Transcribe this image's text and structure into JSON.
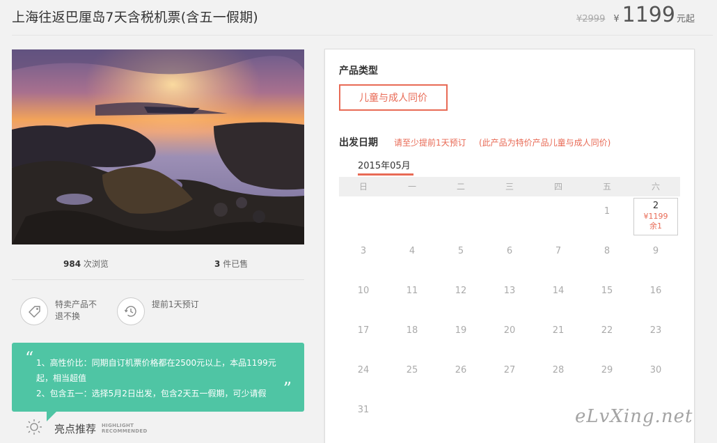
{
  "header": {
    "title": "上海往返巴厘岛7天含税机票(含五一假期)",
    "price_old": "¥2999",
    "currency": "¥",
    "price": "1199",
    "price_suffix": "元起"
  },
  "stats": {
    "views_num": "984",
    "views_label": "次浏览",
    "sold_num": "3",
    "sold_label": "件已售"
  },
  "features": [
    {
      "icon": "tag-icon",
      "text": "特卖产品不退不换"
    },
    {
      "icon": "clock-history-icon",
      "text": "提前1天预订"
    }
  ],
  "highlight": {
    "line1": "1、高性价比：同期自订机票价格都在2500元以上，本品1199元起，相当超值",
    "line2": "2、包含五一：选择5月2日出发，包含2天五一假期，可少请假",
    "quote_open": "“",
    "quote_close": "”",
    "label": "亮点推荐",
    "label_en1": "HIGHLIGHT",
    "label_en2": "RECOMMENDED",
    "accent": "#4fc5a4"
  },
  "panel": {
    "product_type_label": "产品类型",
    "product_type_option": "儿童与成人同价",
    "departure_label": "出发日期",
    "note1": "请至少提前1天预订",
    "note2": "(此产品为特价产品儿童与成人同价)",
    "accent": "#e86a55"
  },
  "calendar": {
    "month": "2015年05月",
    "weekdays": [
      "日",
      "一",
      "二",
      "三",
      "四",
      "五",
      "六"
    ],
    "first_weekday": 5,
    "days": [
      "1",
      "2",
      "3",
      "4",
      "5",
      "6",
      "7",
      "8",
      "9",
      "10",
      "11",
      "12",
      "13",
      "14",
      "15",
      "16",
      "17",
      "18",
      "19",
      "20",
      "21",
      "22",
      "23",
      "24",
      "25",
      "26",
      "27",
      "28",
      "29",
      "30",
      "31"
    ],
    "available": {
      "day": "2",
      "price": "¥1199",
      "remaining": "余1"
    }
  },
  "watermark": "eLvXing.net"
}
